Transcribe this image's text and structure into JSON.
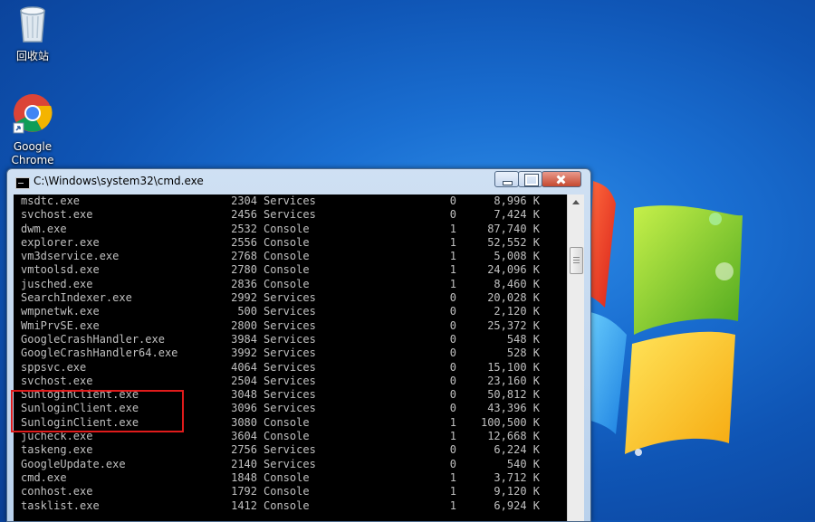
{
  "desktop": {
    "icons": [
      {
        "label": "回收站",
        "icon": "recycle-bin-icon"
      },
      {
        "label": "Google\nChrome",
        "icon": "chrome-icon"
      }
    ]
  },
  "window": {
    "title": "C:\\Windows\\system32\\cmd.exe",
    "icon": "cmd-icon"
  },
  "processes": [
    {
      "name": "msdtc.exe",
      "pid": "2304",
      "session": "Services",
      "num": "0",
      "mem": "8,996 K"
    },
    {
      "name": "svchost.exe",
      "pid": "2456",
      "session": "Services",
      "num": "0",
      "mem": "7,424 K"
    },
    {
      "name": "dwm.exe",
      "pid": "2532",
      "session": "Console",
      "num": "1",
      "mem": "87,740 K"
    },
    {
      "name": "explorer.exe",
      "pid": "2556",
      "session": "Console",
      "num": "1",
      "mem": "52,552 K"
    },
    {
      "name": "vm3dservice.exe",
      "pid": "2768",
      "session": "Console",
      "num": "1",
      "mem": "5,008 K"
    },
    {
      "name": "vmtoolsd.exe",
      "pid": "2780",
      "session": "Console",
      "num": "1",
      "mem": "24,096 K"
    },
    {
      "name": "jusched.exe",
      "pid": "2836",
      "session": "Console",
      "num": "1",
      "mem": "8,460 K"
    },
    {
      "name": "SearchIndexer.exe",
      "pid": "2992",
      "session": "Services",
      "num": "0",
      "mem": "20,028 K"
    },
    {
      "name": "wmpnetwk.exe",
      "pid": "500",
      "session": "Services",
      "num": "0",
      "mem": "2,120 K"
    },
    {
      "name": "WmiPrvSE.exe",
      "pid": "2800",
      "session": "Services",
      "num": "0",
      "mem": "25,372 K"
    },
    {
      "name": "GoogleCrashHandler.exe",
      "pid": "3984",
      "session": "Services",
      "num": "0",
      "mem": "548 K"
    },
    {
      "name": "GoogleCrashHandler64.exe",
      "pid": "3992",
      "session": "Services",
      "num": "0",
      "mem": "528 K"
    },
    {
      "name": "sppsvc.exe",
      "pid": "4064",
      "session": "Services",
      "num": "0",
      "mem": "15,100 K"
    },
    {
      "name": "svchost.exe",
      "pid": "2504",
      "session": "Services",
      "num": "0",
      "mem": "23,160 K"
    },
    {
      "name": "SunloginClient.exe",
      "pid": "3048",
      "session": "Services",
      "num": "0",
      "mem": "50,812 K"
    },
    {
      "name": "SunloginClient.exe",
      "pid": "3096",
      "session": "Services",
      "num": "0",
      "mem": "43,396 K"
    },
    {
      "name": "SunloginClient.exe",
      "pid": "3080",
      "session": "Console",
      "num": "1",
      "mem": "100,500 K"
    },
    {
      "name": "jucheck.exe",
      "pid": "3604",
      "session": "Console",
      "num": "1",
      "mem": "12,668 K"
    },
    {
      "name": "taskeng.exe",
      "pid": "2756",
      "session": "Services",
      "num": "0",
      "mem": "6,224 K"
    },
    {
      "name": "GoogleUpdate.exe",
      "pid": "2140",
      "session": "Services",
      "num": "0",
      "mem": "540 K"
    },
    {
      "name": "cmd.exe",
      "pid": "1848",
      "session": "Console",
      "num": "1",
      "mem": "3,712 K"
    },
    {
      "name": "conhost.exe",
      "pid": "1792",
      "session": "Console",
      "num": "1",
      "mem": "9,120 K"
    },
    {
      "name": "tasklist.exe",
      "pid": "1412",
      "session": "Console",
      "num": "1",
      "mem": "6,924 K"
    }
  ],
  "highlight": {
    "color": "#e01b1b"
  }
}
